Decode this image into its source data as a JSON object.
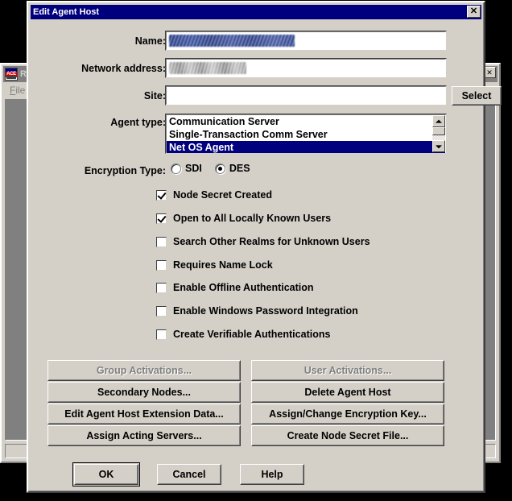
{
  "background_window": {
    "icon": "ace-server-icon",
    "title": "RS",
    "menu": [
      {
        "label": "File",
        "accel": "F"
      }
    ],
    "buttons": [
      {
        "name": "restore-button",
        "glyph": "restore"
      },
      {
        "name": "close-button",
        "glyph": "x"
      }
    ]
  },
  "dialog": {
    "title": "Edit Agent Host",
    "close_button": "✕",
    "fields": [
      {
        "label": "Name:",
        "value": "",
        "redacted": "selected"
      },
      {
        "label": "Network address:",
        "value": "",
        "redacted": "gray"
      },
      {
        "label": "Site:",
        "value": "",
        "placeholder": ""
      }
    ],
    "site_select_button": "Select",
    "agent_type": {
      "label": "Agent type:",
      "options": [
        "Communication Server",
        "Single-Transaction Comm Server",
        "Net OS Agent"
      ],
      "selected_index": 2
    },
    "encryption_type": {
      "label": "Encryption Type:",
      "options": [
        {
          "label": "SDI",
          "checked": false
        },
        {
          "label": "DES",
          "checked": true
        }
      ]
    },
    "checkboxes": [
      {
        "label": "Node Secret Created",
        "checked": true
      },
      {
        "label": "Open to All Locally Known Users",
        "checked": true
      },
      {
        "label": "Search Other Realms for Unknown Users",
        "checked": false
      },
      {
        "label": "Requires Name Lock",
        "checked": false
      },
      {
        "label": "Enable Offline Authentication",
        "checked": false
      },
      {
        "label": "Enable Windows Password Integration",
        "checked": false
      },
      {
        "label": "Create Verifiable Authentications",
        "checked": false
      }
    ],
    "action_buttons_left": [
      {
        "label": "Group Activations...",
        "enabled": false
      },
      {
        "label": "Secondary Nodes...",
        "enabled": true
      },
      {
        "label": "Edit Agent Host Extension Data...",
        "enabled": true
      },
      {
        "label": "Assign Acting Servers...",
        "enabled": true
      }
    ],
    "action_buttons_right": [
      {
        "label": "User Activations...",
        "enabled": false
      },
      {
        "label": "Delete Agent Host",
        "enabled": true
      },
      {
        "label": "Assign/Change Encryption Key...",
        "enabled": true
      },
      {
        "label": "Create Node Secret File...",
        "enabled": true
      }
    ],
    "footer_buttons": [
      {
        "label": "OK",
        "default": true
      },
      {
        "label": "Cancel",
        "default": false
      },
      {
        "label": "Help",
        "default": false
      }
    ]
  },
  "colors": {
    "dialog_face": "#d4d0c8",
    "titlebar_active": "#00007f",
    "titlebar_inactive": "#808080",
    "selection": "#00007f",
    "mdi_client": "#808080",
    "disabled_text": "#808080"
  }
}
